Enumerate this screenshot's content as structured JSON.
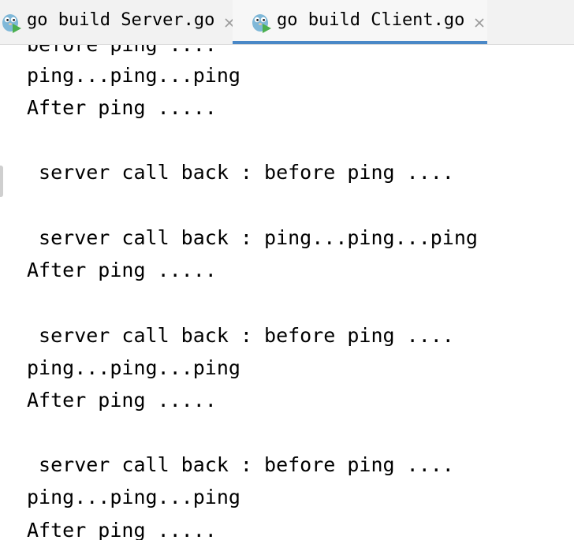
{
  "tabs": [
    {
      "label": "go build Server.go",
      "active": false,
      "icon": "gopher-run-icon"
    },
    {
      "label": "go build Client.go",
      "active": true,
      "icon": "gopher-run-icon"
    }
  ],
  "colors": {
    "active_tab_underline": "#4a88c7",
    "tabbar_background": "#f2f2f2",
    "console_background": "#ffffff",
    "text": "#000000"
  },
  "console": {
    "lines": [
      "before ping ....",
      "ping...ping...ping",
      "After ping .....",
      "",
      " server call back : before ping ....",
      "",
      " server call back : ping...ping...ping",
      "After ping .....",
      "",
      " server call back : before ping ....",
      "ping...ping...ping",
      "After ping .....",
      "",
      " server call back : before ping ....",
      "ping...ping...ping",
      "After ping ....."
    ]
  }
}
